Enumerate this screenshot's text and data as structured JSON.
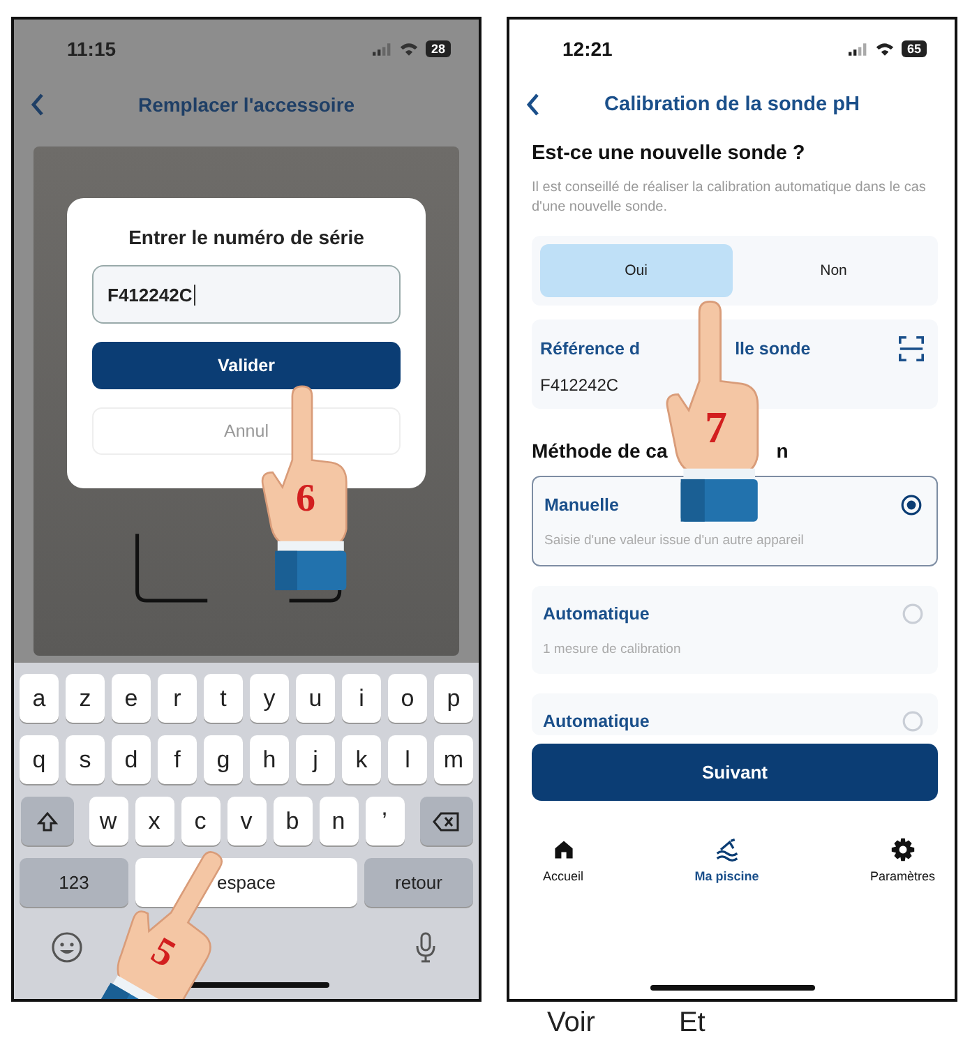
{
  "left_screen": {
    "status_bar": {
      "time": "11:15",
      "battery": "28"
    },
    "nav_title": "Remplacer l'accessoire",
    "dialog": {
      "title": "Entrer le numéro de série",
      "input": {
        "value": "F412242C"
      },
      "buttons": [
        {
          "label": "Valider",
          "kind": "primary"
        },
        {
          "label": "Annul",
          "kind": "secondary"
        }
      ]
    },
    "keyboard": {
      "rows": [
        {
          "keys": [
            {
              "kind": "letter",
              "label": "a"
            },
            {
              "kind": "letter",
              "label": "z"
            },
            {
              "kind": "letter",
              "label": "e"
            },
            {
              "kind": "letter",
              "label": "r"
            },
            {
              "kind": "letter",
              "label": "t"
            },
            {
              "kind": "letter",
              "label": "y"
            },
            {
              "kind": "letter",
              "label": "u"
            },
            {
              "kind": "letter",
              "label": "i"
            },
            {
              "kind": "letter",
              "label": "o"
            },
            {
              "kind": "letter",
              "label": "p"
            }
          ]
        },
        {
          "keys": [
            {
              "kind": "letter",
              "label": "q"
            },
            {
              "kind": "letter",
              "label": "s"
            },
            {
              "kind": "letter",
              "label": "d"
            },
            {
              "kind": "letter",
              "label": "f"
            },
            {
              "kind": "letter",
              "label": "g"
            },
            {
              "kind": "letter",
              "label": "h"
            },
            {
              "kind": "letter",
              "label": "j"
            },
            {
              "kind": "letter",
              "label": "k"
            },
            {
              "kind": "letter",
              "label": "l"
            },
            {
              "kind": "letter",
              "label": "m"
            }
          ]
        },
        {
          "keys": [
            {
              "kind": "shift"
            },
            {
              "kind": "letter",
              "label": "w"
            },
            {
              "kind": "letter",
              "label": "x"
            },
            {
              "kind": "letter",
              "label": "c"
            },
            {
              "kind": "letter",
              "label": "v"
            },
            {
              "kind": "letter",
              "label": "b"
            },
            {
              "kind": "letter",
              "label": "n"
            },
            {
              "kind": "letter",
              "label": "’"
            },
            {
              "kind": "delete"
            }
          ]
        },
        {
          "keys": [
            {
              "kind": "function",
              "label": "123"
            },
            {
              "kind": "space",
              "label": "espace"
            },
            {
              "kind": "function",
              "label": "retour"
            }
          ]
        }
      ]
    },
    "pointers": [
      {
        "step": "6"
      },
      {
        "step": "5"
      }
    ]
  },
  "right_screen": {
    "status_bar": {
      "time": "12:21",
      "battery": "65"
    },
    "nav_title": "Calibration de la sonde pH",
    "question": {
      "title": "Est-ce une nouvelle sonde ?",
      "hint": "Il est conseillé de réaliser la calibration automatique dans le cas d'une nouvelle sonde.",
      "options": [
        {
          "label": "Oui",
          "selected": true
        },
        {
          "label": "Non",
          "selected": false
        }
      ]
    },
    "reference": {
      "label_parts": [
        "Référence d",
        "lle sonde"
      ],
      "value": "F412242C"
    },
    "method": {
      "title_parts": [
        "Méthode de ca",
        "n"
      ],
      "options": [
        {
          "title": "Manuelle",
          "subtitle": "Saisie d'une valeur issue d'un autre appareil",
          "selected": true
        },
        {
          "title": "Automatique",
          "subtitle": "1 mesure de calibration",
          "selected": false
        },
        {
          "title": "Automatique",
          "selected": false
        }
      ]
    },
    "next_button": "Suivant",
    "tab_bar": [
      {
        "label": "Accueil",
        "kind": "home",
        "selected": false
      },
      {
        "label": "Ma piscine",
        "kind": "pool",
        "selected": true
      },
      {
        "label": "Paramètres",
        "kind": "settings",
        "selected": false
      }
    ],
    "pointers": [
      {
        "step": "7"
      }
    ]
  },
  "caption": [
    "Voir",
    "Et"
  ]
}
